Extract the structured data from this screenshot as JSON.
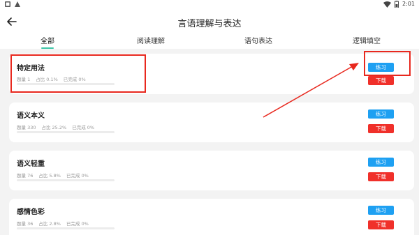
{
  "status_bar": {
    "time": "2:01",
    "left_icons": [
      "settings-icon",
      "storage-icon"
    ],
    "right_icons": [
      "wifi-icon",
      "battery-icon"
    ]
  },
  "header": {
    "title": "言语理解与表达",
    "back_icon": "arrow-left-icon"
  },
  "tabs": [
    {
      "label": "全部",
      "active": true
    },
    {
      "label": "阅读理解",
      "active": false
    },
    {
      "label": "语句表达",
      "active": false
    },
    {
      "label": "逻辑填空",
      "active": false
    }
  ],
  "cards": [
    {
      "title": "特定用法",
      "count": "题量 1",
      "ratio": "占比 0.1%",
      "done": "已完成 0%",
      "progress": 0,
      "practice_label": "练习",
      "download_label": "下载"
    },
    {
      "title": "语义本义",
      "count": "题量 330",
      "ratio": "占比 25.2%",
      "done": "已完成 0%",
      "progress": 0,
      "practice_label": "练习",
      "download_label": "下载"
    },
    {
      "title": "语义轻重",
      "count": "题量 76",
      "ratio": "占比 5.8%",
      "done": "已完成 0%",
      "progress": 0,
      "practice_label": "练习",
      "download_label": "下载"
    },
    {
      "title": "感情色彩",
      "count": "题量 36",
      "ratio": "占比 2.8%",
      "done": "已完成 0%",
      "progress": 0,
      "practice_label": "练习",
      "download_label": "下载"
    }
  ],
  "colors": {
    "accent": "#3ec7a8",
    "practice_button": "#1ea0f2",
    "download_button": "#f0302a",
    "annotation": "#e8281e"
  }
}
